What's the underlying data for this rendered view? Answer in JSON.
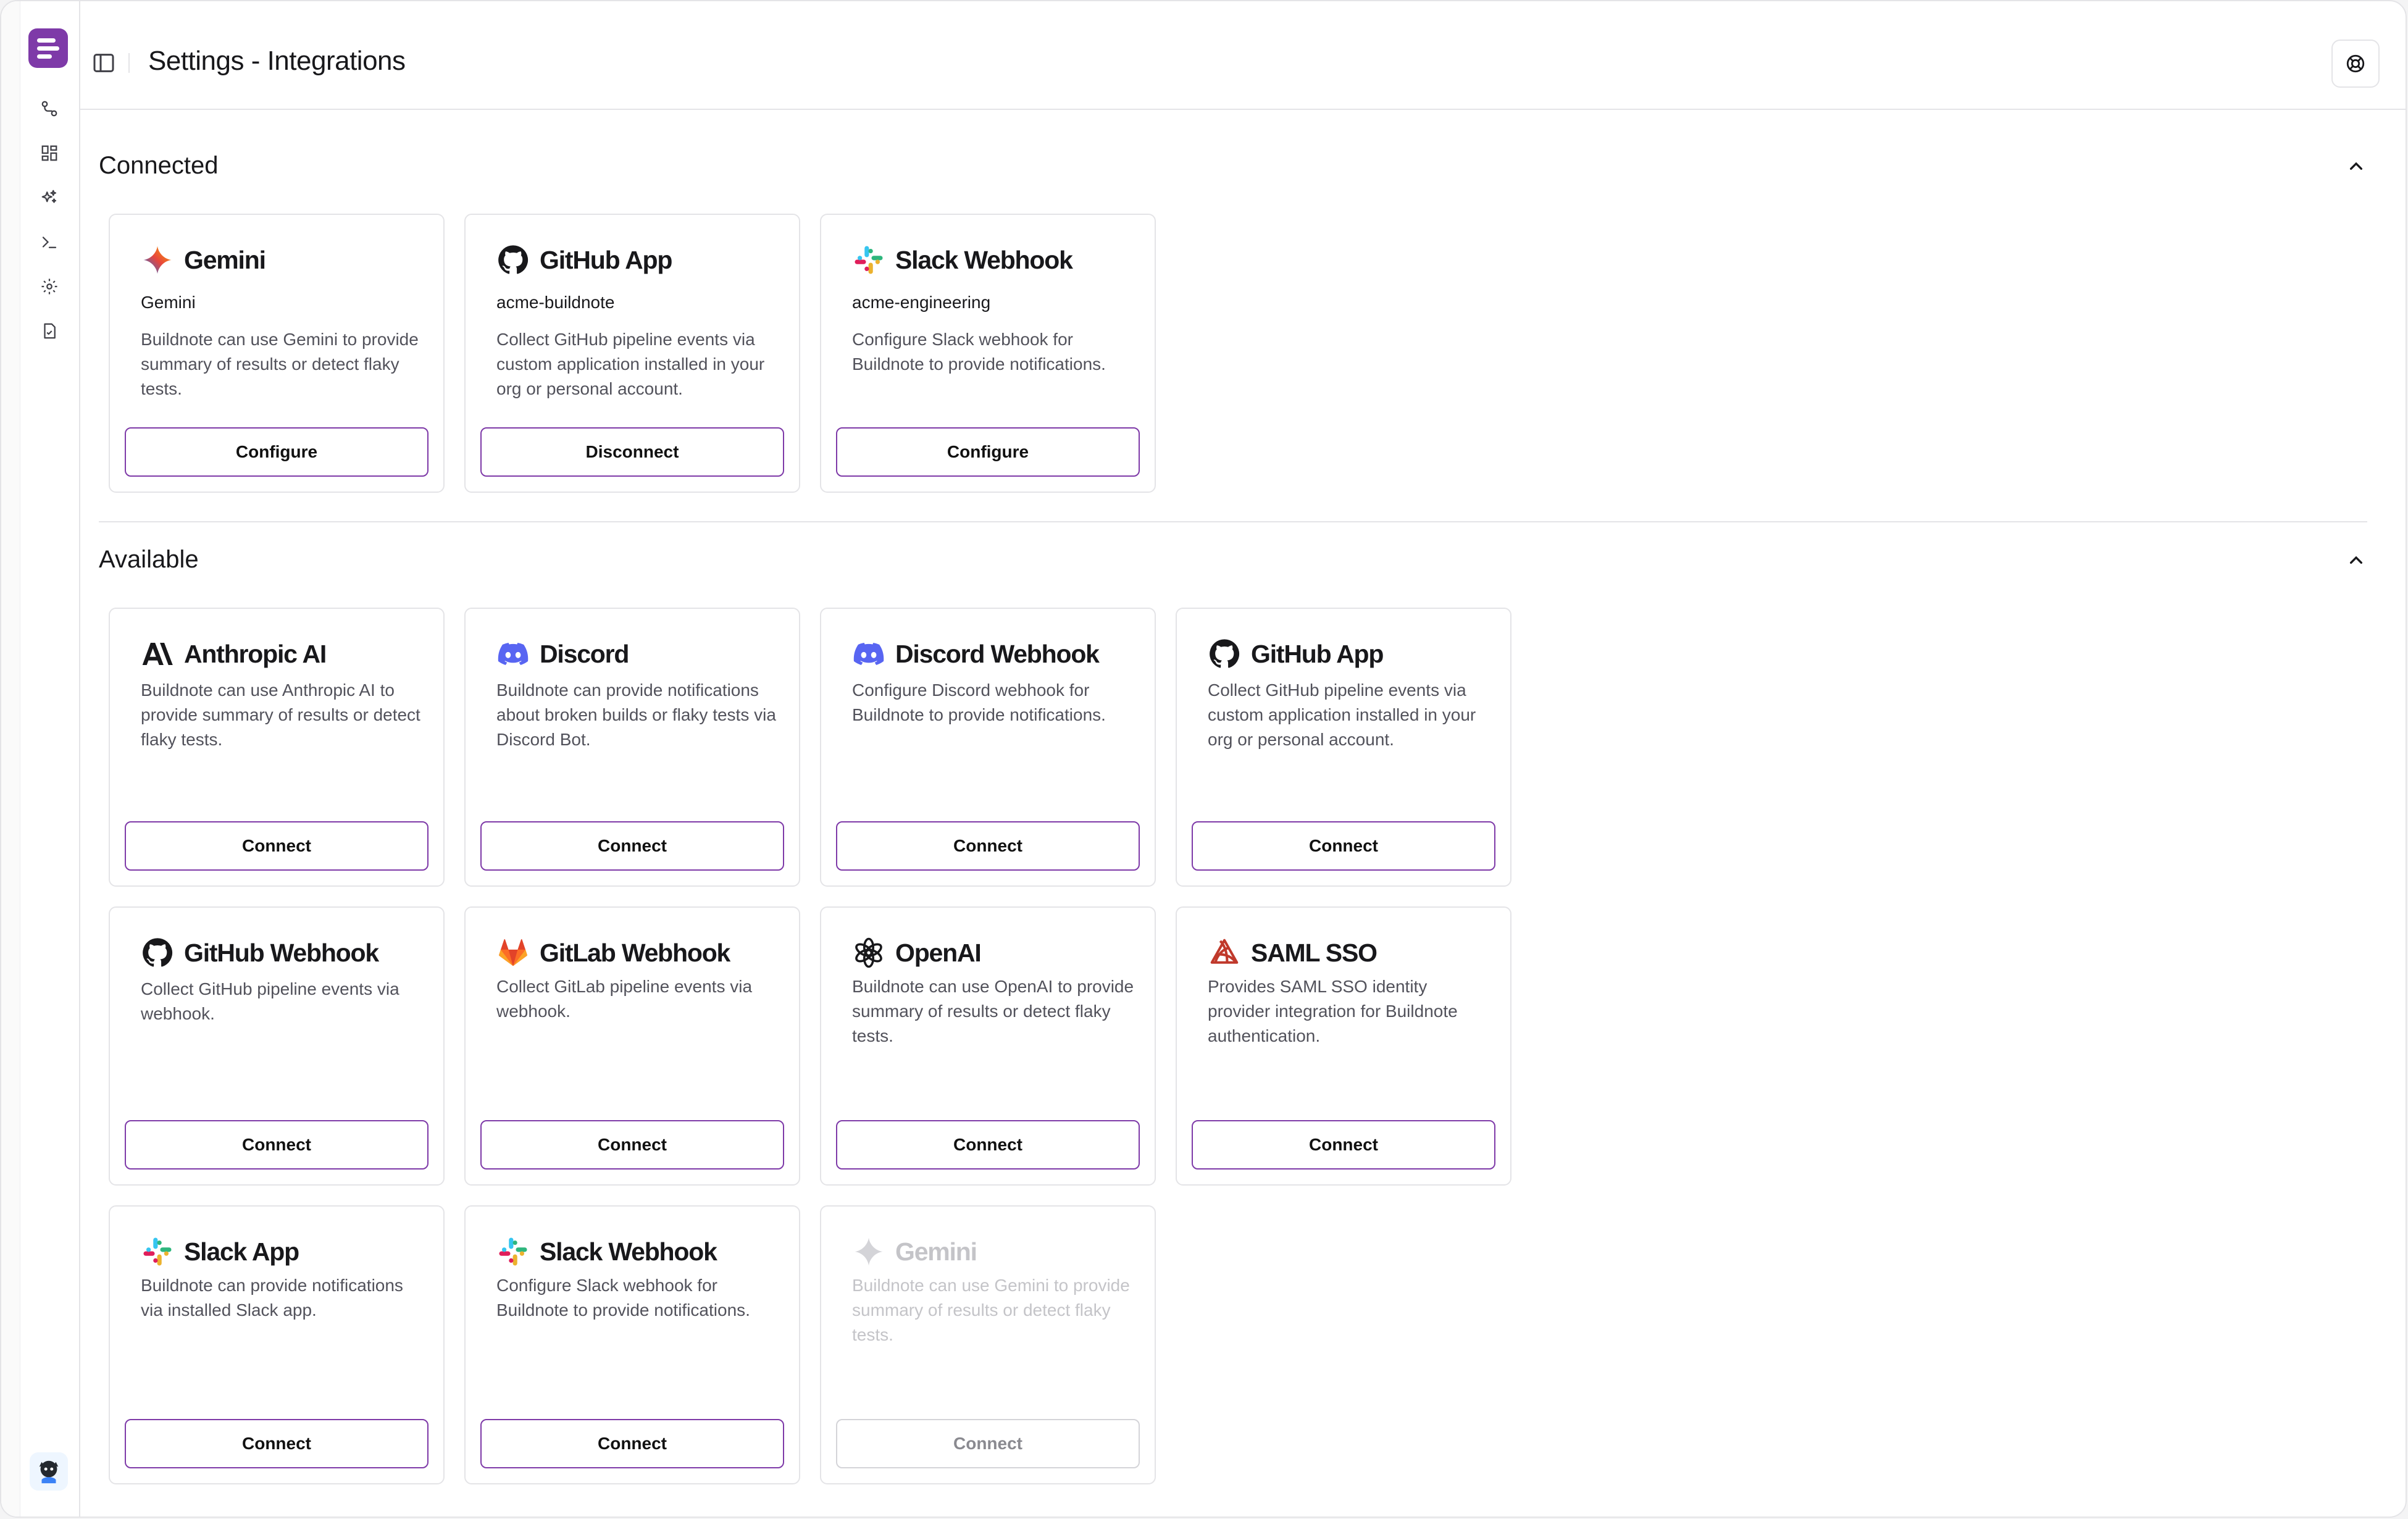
{
  "header": {
    "title": "Settings - Integrations"
  },
  "sidebar": {
    "items": [
      {
        "icon": "workflow-icon"
      },
      {
        "icon": "dashboard-icon"
      },
      {
        "icon": "sparkles-icon"
      },
      {
        "icon": "terminal-icon"
      },
      {
        "icon": "gear-icon"
      },
      {
        "icon": "document-icon"
      }
    ]
  },
  "sections": {
    "connected": {
      "title": "Connected",
      "cards": [
        {
          "name": "Gemini",
          "account": "Gemini",
          "description": "Buildnote can use Gemini to provide summary of results or detect flaky tests.",
          "button": "Configure",
          "icon": "gemini-icon"
        },
        {
          "name": "GitHub App",
          "account": "acme-buildnote",
          "description": "Collect GitHub pipeline events via custom application installed in your org or personal account.",
          "button": "Disconnect",
          "icon": "github-icon"
        },
        {
          "name": "Slack Webhook",
          "account": "acme-engineering",
          "description": "Configure Slack webhook for Buildnote to provide notifications.",
          "button": "Configure",
          "icon": "slack-icon"
        }
      ]
    },
    "available": {
      "title": "Available",
      "cards": [
        {
          "name": "Anthropic AI",
          "description": "Buildnote can use Anthropic AI to provide summary of results or detect flaky tests.",
          "button": "Connect",
          "icon": "anthropic-icon"
        },
        {
          "name": "Discord",
          "description": "Buildnote can provide notifications about broken builds or flaky tests via Discord Bot.",
          "button": "Connect",
          "icon": "discord-icon"
        },
        {
          "name": "Discord Webhook",
          "description": "Configure Discord webhook for Buildnote to provide notifications.",
          "button": "Connect",
          "icon": "discord-icon"
        },
        {
          "name": "GitHub App",
          "description": "Collect GitHub pipeline events via custom application installed in your org or personal account.",
          "button": "Connect",
          "icon": "github-icon"
        },
        {
          "name": "GitHub Webhook",
          "description": "Collect GitHub pipeline events via webhook.",
          "button": "Connect",
          "icon": "github-icon"
        },
        {
          "name": "GitLab Webhook",
          "description": "Collect GitLab pipeline events via webhook.",
          "button": "Connect",
          "icon": "gitlab-icon"
        },
        {
          "name": "OpenAI",
          "description": "Buildnote can use OpenAI to provide summary of results or detect flaky tests.",
          "button": "Connect",
          "icon": "openai-icon"
        },
        {
          "name": "SAML SSO",
          "description": "Provides SAML SSO identity provider integration for Buildnote authentication.",
          "button": "Connect",
          "icon": "saml-icon"
        },
        {
          "name": "Slack App",
          "description": "Buildnote can provide notifications via installed Slack app.",
          "button": "Connect",
          "icon": "slack-icon"
        },
        {
          "name": "Slack Webhook",
          "description": "Configure Slack webhook for Buildnote to provide notifications.",
          "button": "Connect",
          "icon": "slack-icon"
        },
        {
          "name": "Gemini",
          "description": "Buildnote can use Gemini to provide summary of results or detect flaky tests.",
          "button": "Connect",
          "icon": "gemini-icon",
          "disabled": true
        }
      ]
    }
  },
  "colors": {
    "accent": "#7e3aa8",
    "border": "#e4e4e7",
    "muted_text": "#52525b"
  }
}
